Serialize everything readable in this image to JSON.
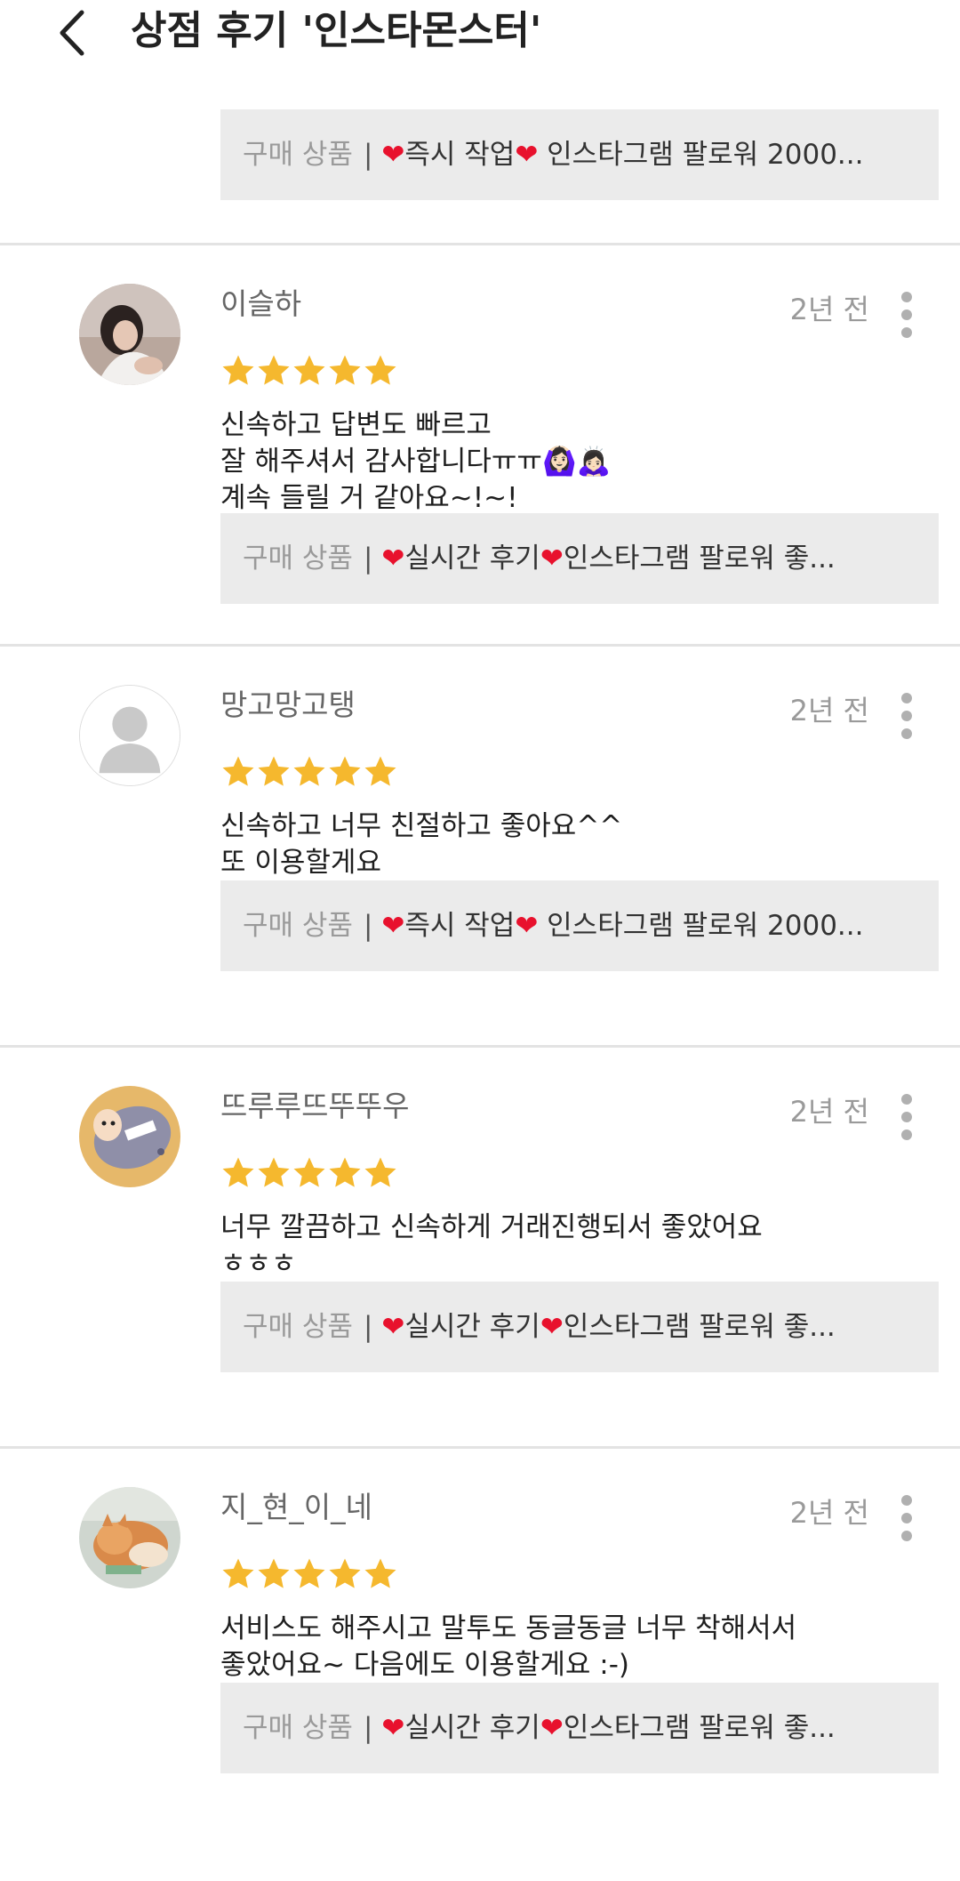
{
  "header": {
    "title": "상점 후기 '인스타몬스터'"
  },
  "top_product": {
    "label": "구매 상품",
    "separator": "|",
    "name_a": "즉시 작업",
    "name_b": " 인스타그램 팔로워 2000..."
  },
  "reviews": [
    {
      "username": "이슬하",
      "date": "2년 전",
      "rating": 5,
      "lines": [
        "신속하고 답변도 빠르고",
        "잘 해주셔서 감사합니다ㅠㅠ🙆🏻‍♀️🙇🏻‍♀️",
        "계속 들릴 거 같아요~!~!"
      ],
      "product": {
        "label": "구매 상품",
        "separator": "|",
        "name_a": "실시간 후기",
        "name_b": "인스타그램  팔로워 좋..."
      }
    },
    {
      "username": "망고망고탱",
      "date": "2년 전",
      "rating": 5,
      "lines": [
        "신속하고 너무 친절하고 좋아요^^",
        "또 이용할게요"
      ],
      "product": {
        "label": "구매 상품",
        "separator": "|",
        "name_a": "즉시 작업",
        "name_b": " 인스타그램 팔로워 2000..."
      }
    },
    {
      "username": "뜨루루뜨뚜뚜우",
      "date": "2년 전",
      "rating": 5,
      "lines": [
        "너무 깔끔하고 신속하게 거래진행되서 좋았어요",
        "ㅎㅎㅎ"
      ],
      "product": {
        "label": "구매 상품",
        "separator": "|",
        "name_a": "실시간 후기",
        "name_b": "인스타그램  팔로워 좋..."
      }
    },
    {
      "username": "지_현_이_네",
      "date": "2년 전",
      "rating": 5,
      "lines": [
        "서비스도 해주시고 말투도 동글동글 너무 착해서서",
        "좋았어요~ 다음에도 이용할게요 :-)"
      ],
      "product": {
        "label": "구매 상품",
        "separator": "|",
        "name_a": "실시간 후기",
        "name_b": "인스타그램  팔로워 좋..."
      }
    }
  ],
  "colors": {
    "star": "#f5b82e",
    "heart": "#e8112d",
    "product_bg": "#ebebeb",
    "divider": "#e3e3e3"
  },
  "icons": {
    "back": "chevron-left-icon",
    "more": "more-vertical-icon",
    "star": "star-icon",
    "heart": "heart-icon"
  }
}
